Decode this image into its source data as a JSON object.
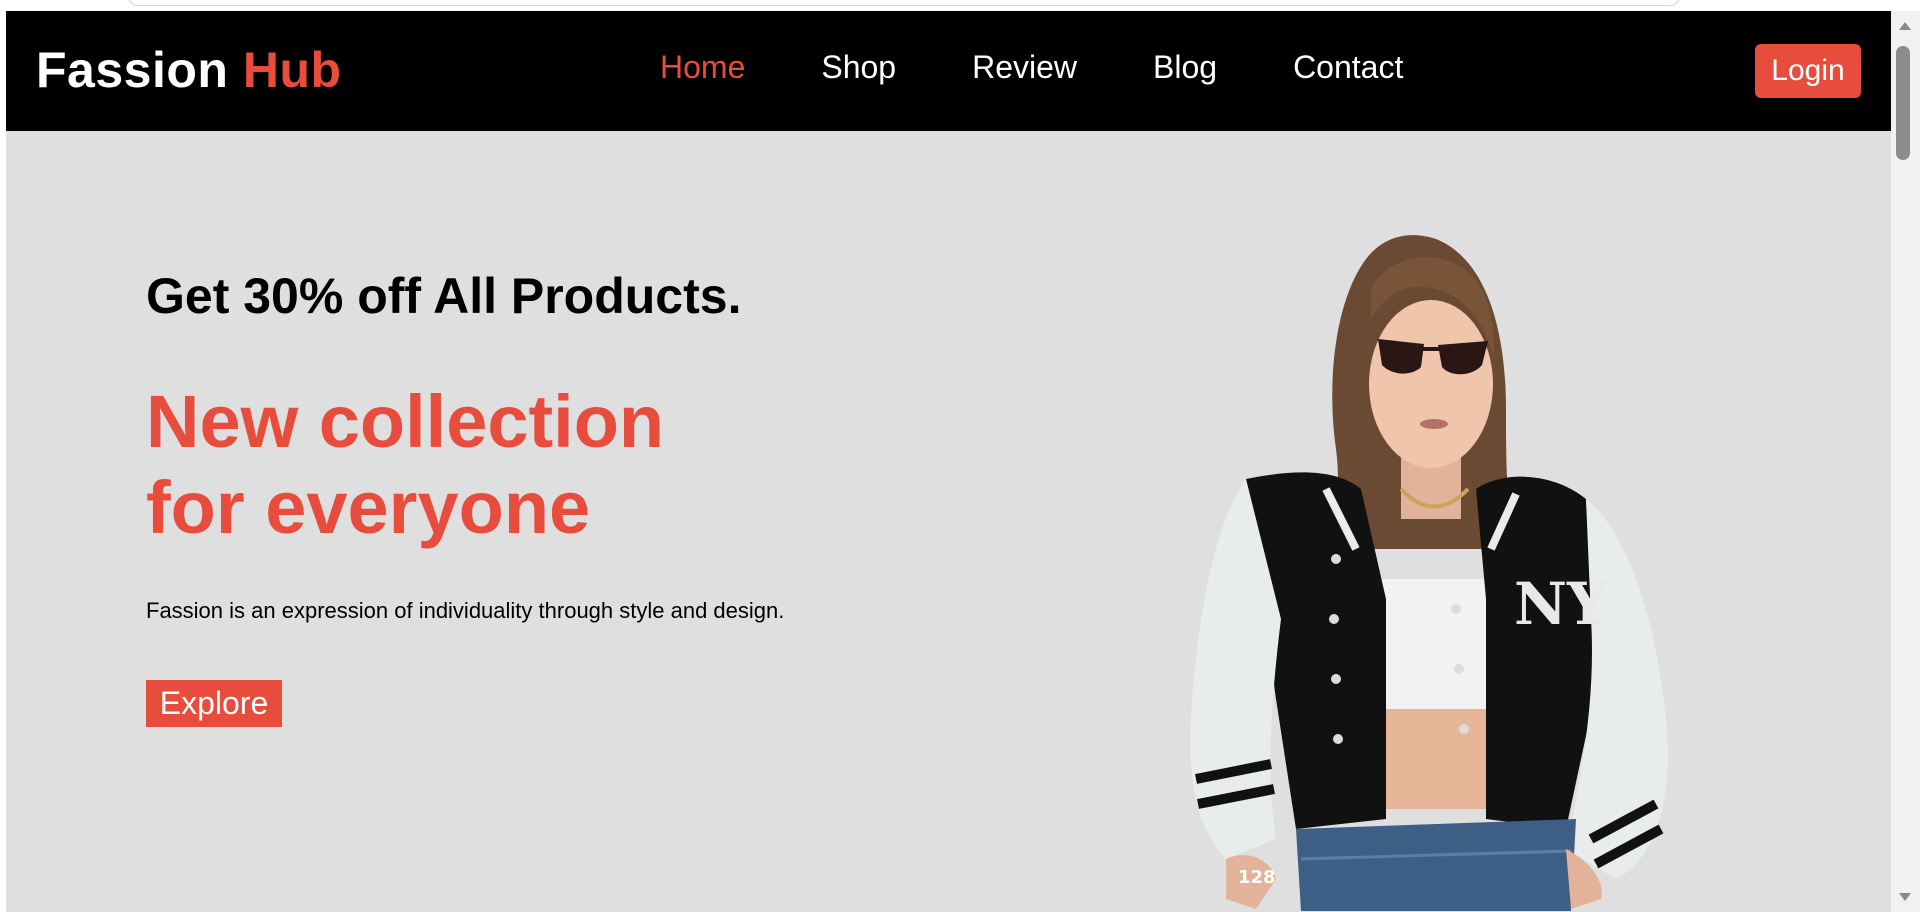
{
  "brand": {
    "name_part1": "Fassion",
    "name_part2": "Hub"
  },
  "nav": {
    "items": [
      {
        "label": "Home",
        "active": true
      },
      {
        "label": "Shop",
        "active": false
      },
      {
        "label": "Review",
        "active": false
      },
      {
        "label": "Blog",
        "active": false
      },
      {
        "label": "Contact",
        "active": false
      }
    ],
    "login_label": "Login"
  },
  "hero": {
    "promo": "Get 30% off All Products.",
    "headline_line1": "New collection",
    "headline_line2": "for everyone",
    "tagline": "Fassion is an expression of individuality through style and design.",
    "cta_label": "Explore",
    "image_badge": "128"
  },
  "colors": {
    "accent": "#e84c3d",
    "navbar_bg": "#000000",
    "hero_bg": "#dfdfdf"
  },
  "icons": {
    "scroll_up": "scroll-up-arrow-icon",
    "scroll_down": "scroll-down-arrow-icon"
  }
}
